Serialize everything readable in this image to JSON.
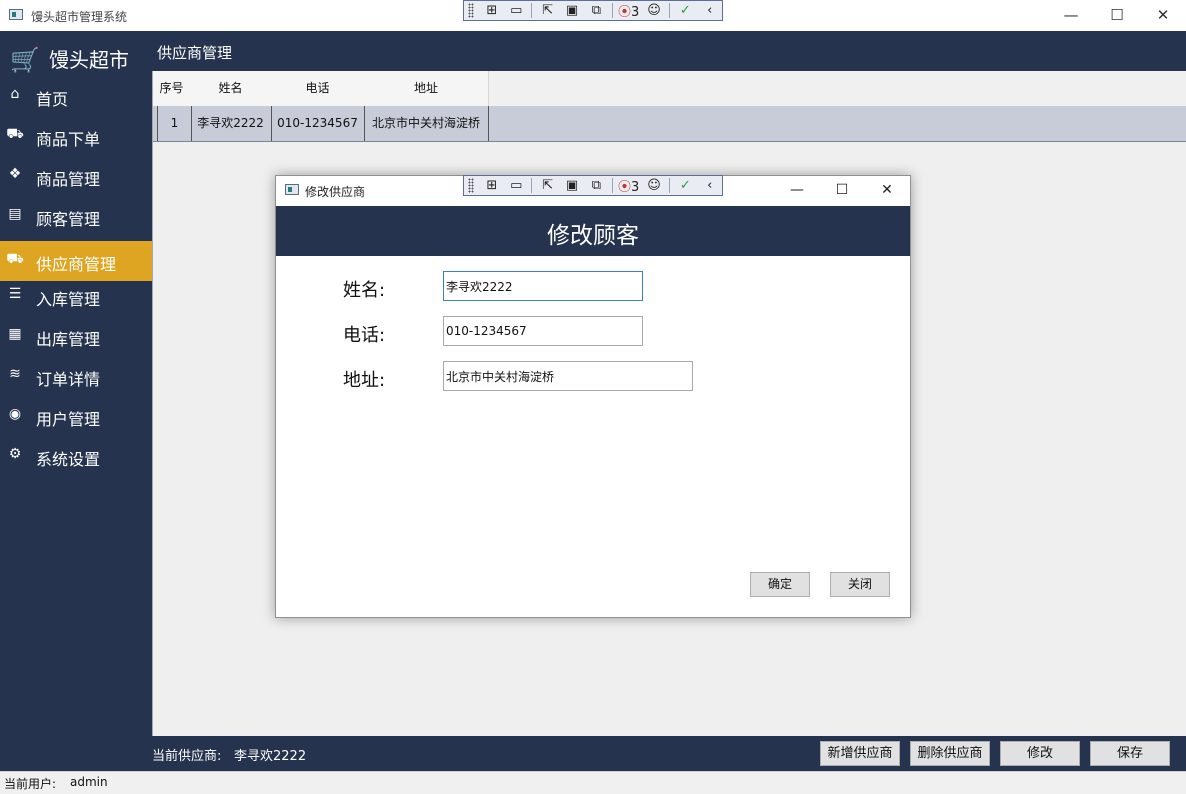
{
  "window": {
    "title": "馒头超市管理系统"
  },
  "debug_toolbar": {
    "badge_count": "3"
  },
  "sidebar": {
    "app_name": "馒头超市",
    "items": [
      {
        "label": "首页",
        "icon": "home-icon",
        "glyph": "⌂"
      },
      {
        "label": "商品下单",
        "icon": "cart-icon",
        "glyph": "⛟"
      },
      {
        "label": "商品管理",
        "icon": "dropbox-icon",
        "glyph": "❖"
      },
      {
        "label": "顾客管理",
        "icon": "contact-card-icon",
        "glyph": "▤"
      },
      {
        "label": "供应商管理",
        "icon": "truck-icon",
        "glyph": "⛟"
      },
      {
        "label": "入库管理",
        "icon": "list-icon",
        "glyph": "☰"
      },
      {
        "label": "出库管理",
        "icon": "table-icon",
        "glyph": "▦"
      },
      {
        "label": "订单详情",
        "icon": "wifi-icon",
        "glyph": "≋"
      },
      {
        "label": "用户管理",
        "icon": "user-circle-icon",
        "glyph": "◉"
      },
      {
        "label": "系统设置",
        "icon": "cogs-icon",
        "glyph": "⚙"
      }
    ],
    "active_index": 4
  },
  "main": {
    "title": "供应商管理",
    "table": {
      "columns": [
        "序号",
        "姓名",
        "电话",
        "地址"
      ],
      "rows": [
        [
          "1",
          "李寻欢2222",
          "010-1234567",
          "北京市中关村海淀桥"
        ]
      ]
    }
  },
  "footer": {
    "current_supplier_label": "当前供应商:",
    "current_supplier_value": "李寻欢2222",
    "buttons": {
      "add": "新增供应商",
      "delete": "删除供应商",
      "edit": "修改",
      "save": "保存"
    }
  },
  "statusbar": {
    "label": "当前用户:",
    "user": "admin"
  },
  "dialog": {
    "window_title": "修改供应商",
    "heading": "修改顾客",
    "fields": {
      "name_label": "姓名:",
      "name_value": "李寻欢2222",
      "phone_label": "电话:",
      "phone_value": "010-1234567",
      "address_label": "地址:",
      "address_value": "北京市中关村海淀桥"
    },
    "buttons": {
      "ok": "确定",
      "close": "关闭"
    }
  },
  "colors": {
    "navy": "#25334f",
    "active": "#dda521"
  }
}
